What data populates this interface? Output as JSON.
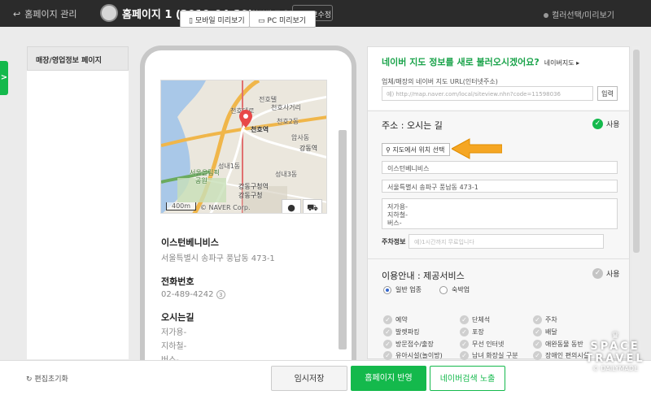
{
  "topbar": {
    "back": "홈페이지 관리",
    "title": "홈페이지 1 (2019-04-30)",
    "hint": "URL을 입력해 주세요",
    "edit_btn": "정보수정",
    "right": "컬러선택/미리보기"
  },
  "side_tab": ">",
  "left_panel": {
    "heading": "매장/영업정보 페이지"
  },
  "preview": {
    "mobile_btn": "모바일 미리보기",
    "pc_btn": "PC 미리보기"
  },
  "map": {
    "labels": [
      "전호텔",
      "천호사거리",
      "천호2동",
      "천호대로",
      "천호역",
      "암사동",
      "강동구청",
      "강동역",
      "성내3동",
      "서울올림픽",
      "공원",
      "성내1동",
      "강동구청역",
      "강동구청"
    ],
    "scale": "400m",
    "credit": "© NAVER Corp."
  },
  "store": {
    "name": "이스턴베니비스",
    "address": "서울특별시 송파구 풍납동 473-1",
    "phone_label": "전화번호",
    "phone": "02-489-4242",
    "directions_label": "오시는길",
    "directions": [
      "저가용-",
      "지하철-",
      "버스-"
    ]
  },
  "right_panel": {
    "question": "네이버 지도 정보를 새로 불러오시겠어요?",
    "question_link": "네이버지도 ▸",
    "url_label": "업체/매장의 네이버 지도 URL(인터넷주소)",
    "url_placeholder": "예) http://map.naver.com/local/siteview.nhn?code=11598036",
    "input_btn": "입력",
    "addr_title": "주소 : 오시는 길",
    "use_label": "사용",
    "loc_btn": "지도에서 위치 선택",
    "store_name": "이스턴베니비스",
    "store_addr": "서울특별시 송파구 풍납동 473-1",
    "directions": [
      "저가용-",
      "지하철-",
      "버스-"
    ],
    "parking_label": "주차정보",
    "parking_placeholder": "예)1시간까지 무료입니다",
    "info_title": "이용안내 : 제공서비스",
    "radio": [
      "일반 업종",
      "숙박업"
    ],
    "services": [
      [
        "예약",
        "단체석",
        "주차"
      ],
      [
        "발렛파킹",
        "포장",
        "배달"
      ],
      [
        "방문접수/출장",
        "무선 인터넷",
        "애완동물 동반"
      ],
      [
        "유아시설(놀이방)",
        "남녀 화장실 구분",
        "장애인 편의시설"
      ]
    ]
  },
  "bottom": {
    "reset": "편집초기화",
    "save": "임시저장",
    "apply": "홈페이지 반영",
    "naver": "네이버검색 노출"
  },
  "watermark": {
    "line1": "SPACE",
    "line2": "TRAVEL",
    "line3": "© DAILYMADE"
  },
  "colors": {
    "green": "#14b94c",
    "topbar": "#2b2b2b",
    "arrow": "#f5a623"
  }
}
